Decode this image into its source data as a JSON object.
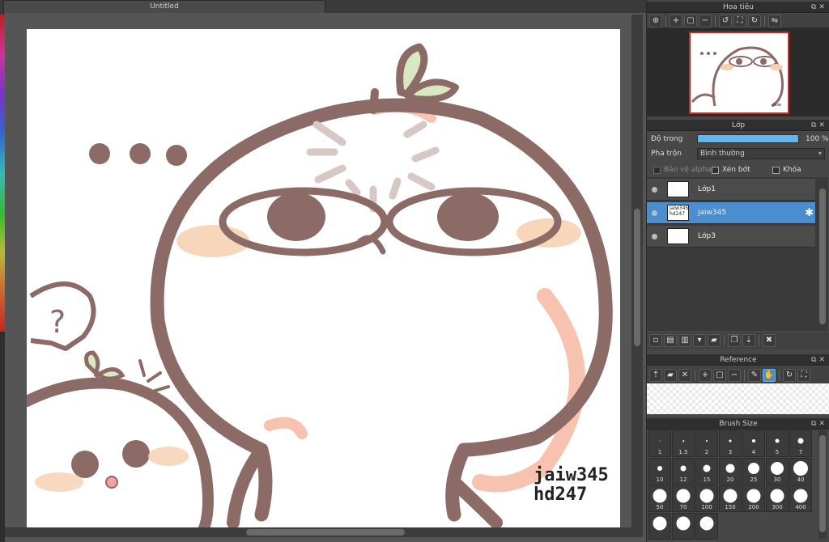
{
  "document": {
    "tab_title": "Untitled",
    "watermark_line1": "jaiw345",
    "watermark_line2": "hd247"
  },
  "panels": {
    "navigator": {
      "title": "Hoa tiêu",
      "icons": [
        "zoom-fit-icon",
        "zoom-in-icon",
        "actual-size-icon",
        "zoom-out-icon",
        "rotate-left-icon",
        "fit-window-icon",
        "rotate-right-icon",
        "flip-icon"
      ]
    },
    "layer": {
      "title": "Lớp",
      "opacity_label": "Độ trong",
      "opacity_value": "100 %",
      "opacity_fraction": 1.0,
      "blend_label": "Pha trộn",
      "blend_value": "Bình thường",
      "protect_alpha_label": "Bảo vệ alpha",
      "clipping_label": "Xén bớt",
      "lock_label": "Khóa",
      "layers": [
        {
          "name": "Lớp1",
          "selected": false,
          "thumb_text": ""
        },
        {
          "name": "jaiw345",
          "selected": true,
          "thumb_text": "jaiw345 hd247"
        },
        {
          "name": "Lớp3",
          "selected": false,
          "thumb_text": ""
        }
      ]
    },
    "reference": {
      "title": "Reference"
    },
    "brush_size": {
      "title": "Brush Size",
      "sizes": [
        "1",
        "1.5",
        "2",
        "3",
        "4",
        "5",
        "7",
        "10",
        "12",
        "15",
        "20",
        "25",
        "30",
        "40",
        "50",
        "70",
        "100",
        "150",
        "200",
        "300",
        "400",
        "",
        "",
        ""
      ]
    }
  },
  "colors": {
    "accent": "#4a8ed0",
    "nav_border": "#c8282a",
    "opacity_bar": "#5eb8f0",
    "line": "#8c6a66",
    "blush": "#f7c3b0",
    "leaf": "#d9e8c0"
  }
}
